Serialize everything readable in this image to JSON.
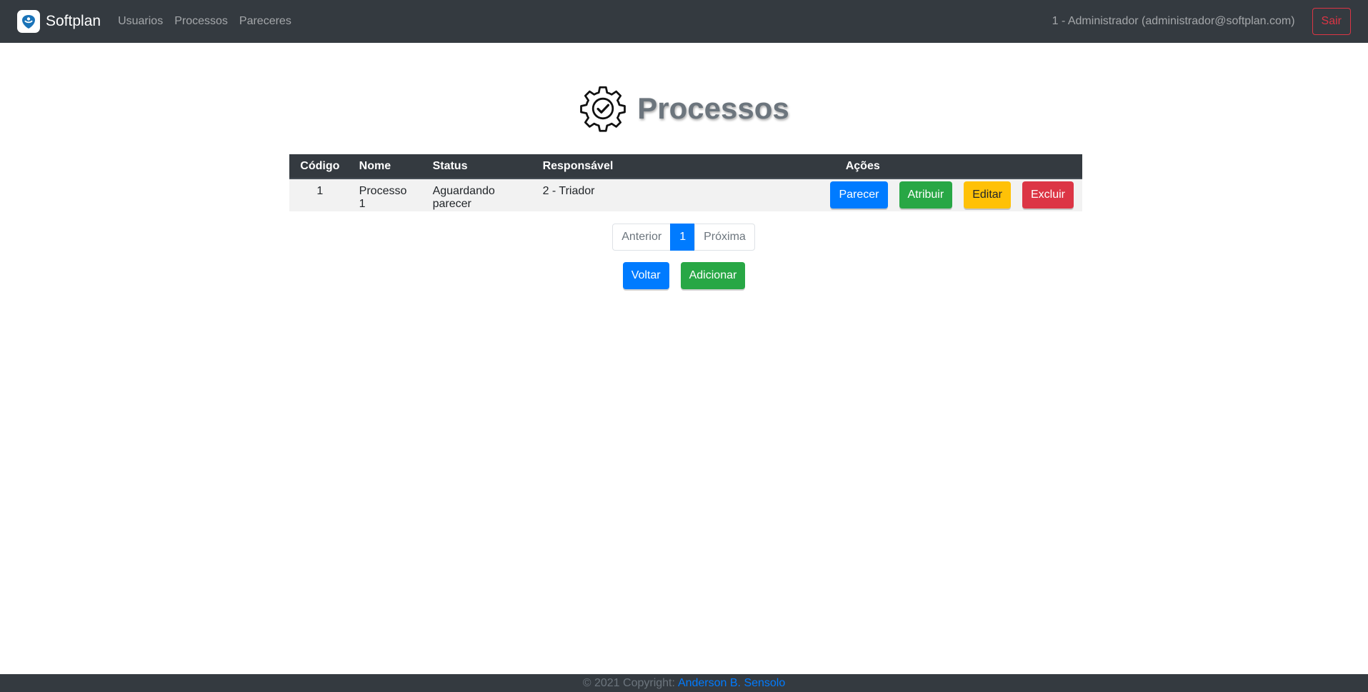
{
  "navbar": {
    "brand": "Softplan",
    "links": [
      "Usuarios",
      "Processos",
      "Pareceres"
    ],
    "user": "1 - Administrador (administrador@softplan.com)",
    "logout": "Sair"
  },
  "page": {
    "title": "Processos"
  },
  "table": {
    "headers": {
      "codigo": "Código",
      "nome": "Nome",
      "status": "Status",
      "responsavel": "Responsável",
      "acoes": "Ações"
    },
    "rows": [
      {
        "codigo": "1",
        "nome": "Processo 1",
        "status": "Aguardando parecer",
        "responsavel": "2 - Triador",
        "actions": {
          "parecer": "Parecer",
          "atribuir": "Atribuir",
          "editar": "Editar",
          "excluir": "Excluir"
        }
      }
    ]
  },
  "pagination": {
    "previous": "Anterior",
    "current": "1",
    "next": "Próxima"
  },
  "buttons": {
    "back": "Voltar",
    "add": "Adicionar"
  },
  "footer": {
    "copyright": "© 2021 Copyright:",
    "author": "Anderson B. Sensolo"
  },
  "colors": {
    "navbar": "#343a40",
    "primary": "#007bff",
    "success": "#28a745",
    "warning": "#ffc107",
    "danger": "#dc3545"
  }
}
